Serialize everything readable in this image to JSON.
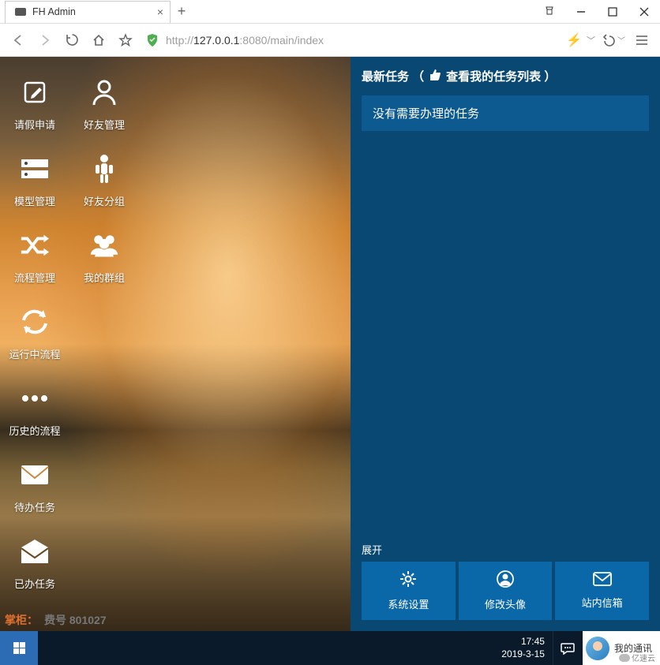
{
  "window": {
    "tab_title": "FH Admin",
    "url_prefix": "http://",
    "url_host": "127.0.0.1",
    "url_port": ":8080",
    "url_path": "/main/index"
  },
  "tiles": {
    "row1": [
      {
        "name": "leave-apply",
        "label": "请假申请"
      },
      {
        "name": "friend-mgmt",
        "label": "好友管理"
      }
    ],
    "row2": [
      {
        "name": "model-mgmt",
        "label": "模型管理"
      },
      {
        "name": "friend-group",
        "label": "好友分组"
      }
    ],
    "row3": [
      {
        "name": "flow-mgmt",
        "label": "流程管理"
      },
      {
        "name": "my-groups",
        "label": "我的群组"
      }
    ],
    "row4": [
      {
        "name": "running-flow",
        "label": "运行中流程"
      }
    ],
    "row5": [
      {
        "name": "history-flow",
        "label": "历史的流程"
      }
    ],
    "row6": [
      {
        "name": "todo-tasks",
        "label": "待办任务"
      }
    ],
    "row7": [
      {
        "name": "done-tasks",
        "label": "已办任务"
      }
    ]
  },
  "bottom_text": {
    "a": "掌柜：",
    "b": "费号 801027"
  },
  "right": {
    "heading_a": "最新任务 （",
    "heading_b": " 查看我的任务列表 ）",
    "no_task": "没有需要办理的任务",
    "expand": "展开",
    "buttons": [
      {
        "name": "sys-settings",
        "label": "系统设置"
      },
      {
        "name": "change-avatar",
        "label": "修改头像"
      },
      {
        "name": "inbox",
        "label": "站内信箱"
      }
    ]
  },
  "taskbar": {
    "time": "17:45",
    "date": "2019-3-15",
    "widget_text": "我的通讯",
    "widget_brand": "亿速云"
  }
}
